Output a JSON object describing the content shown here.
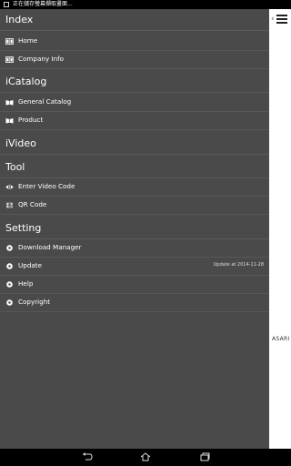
{
  "status": {
    "text": "正在儲存螢幕擷取畫面..."
  },
  "sections": {
    "index": {
      "title": "Index",
      "items": [
        {
          "label": "Home"
        },
        {
          "label": "Company Info"
        }
      ]
    },
    "icatalog": {
      "title": "iCatalog",
      "items": [
        {
          "label": "General Catalog"
        },
        {
          "label": "Product"
        }
      ]
    },
    "ivideo": {
      "title": "iVideo"
    },
    "tool": {
      "title": "Tool",
      "items": [
        {
          "label": "Enter Video Code"
        },
        {
          "label": "QR Code"
        }
      ]
    },
    "setting": {
      "title": "Setting",
      "items": [
        {
          "label": "Download Manager"
        },
        {
          "label": "Update",
          "extra": "Update at 2014-11-28"
        },
        {
          "label": "Help"
        },
        {
          "label": "Copyright"
        }
      ]
    }
  },
  "content": {
    "brand_text": "ASARI"
  }
}
